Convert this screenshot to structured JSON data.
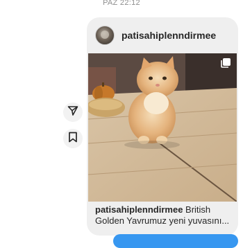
{
  "timestamp": "PAZ 22:12",
  "post": {
    "username": "patisahiplenndirmee",
    "caption_user": "patisahiplenndirmee",
    "caption_text": "British Golden Yavrumuz yeni yuvasını..."
  },
  "icons": {
    "share": "paper-plane-icon",
    "save": "bookmark-icon",
    "carousel": "multiple-photos-icon"
  },
  "colors": {
    "bubble": "#efefef",
    "accent": "#3797f0",
    "text": "#262626",
    "muted": "#8e8e8e"
  }
}
